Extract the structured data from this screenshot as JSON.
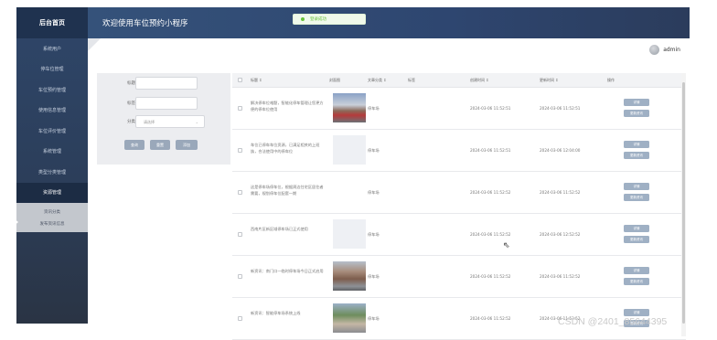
{
  "brand": "后台首页",
  "header": {
    "title": "欢迎使用车位预约小程序",
    "toast": "登录成功"
  },
  "user": {
    "name": "admin"
  },
  "sidebar": {
    "items": [
      {
        "label": "系统用户"
      },
      {
        "label": "停车位管理"
      },
      {
        "label": "车位预约管理"
      },
      {
        "label": "使用信息管理"
      },
      {
        "label": "车位评价管理"
      },
      {
        "label": "系统管理"
      },
      {
        "label": "类型分类管理"
      },
      {
        "label": "资源管理"
      }
    ],
    "sub_items": [
      {
        "label": "资讯分类"
      },
      {
        "label": "发布资讯信息"
      }
    ]
  },
  "search": {
    "labels": [
      "标题",
      "标签",
      "分类"
    ],
    "select_value": "请选择",
    "buttons": {
      "search": "查询",
      "reset": "重置",
      "add": "添加"
    }
  },
  "table": {
    "headers": [
      "标题 ↕",
      "封面图",
      "文章分类 ↕",
      "标签",
      "创建时间 ↕",
      "更新时间 ↕",
      "操作"
    ],
    "rows": [
      {
        "title": "解决停车位难题，智能化停车管理让您更方便的停车位使用",
        "category": "停车场",
        "created": "2024-03-06 11:52:51",
        "updated": "2024-03-06 11:52:51",
        "thumb": "photo"
      },
      {
        "title": "车位已停车车位资源，已满足相关的上班族，合法使用中的停车位",
        "category": "停车场",
        "created": "2024-03-06 11:52:51",
        "updated": "2024-03-06 12:04:00",
        "thumb": "blank"
      },
      {
        "title": "这是停车场停车位，根据周边住宅区居住者需要，规划停车位配套一期",
        "category": "停车场",
        "created": "2024-03-06 11:52:52",
        "updated": "2024-03-06 11:52:52",
        "thumb": "none"
      },
      {
        "title": "西南片区新区域停车场已正式使用",
        "category": "停车场",
        "created": "2024-03-06 11:52:52",
        "updated": "2024-03-06 12:52:52",
        "thumb": "blank"
      },
      {
        "title": "新资讯：南门口一临时停车场今日正式启用",
        "category": "停车场",
        "created": "2024-03-06 11:52:52",
        "updated": "2024-03-06 11:52:52",
        "thumb": "street"
      },
      {
        "title": "新资讯：智能停车场系统上线",
        "category": "停车场",
        "created": "2024-03-06 11:52:52",
        "updated": "2024-03-06 11:52:52",
        "thumb": "green"
      }
    ],
    "actions": {
      "detail": "详情",
      "edit": "更新资讯"
    }
  },
  "watermark": "CSDN @2401_85644395"
}
